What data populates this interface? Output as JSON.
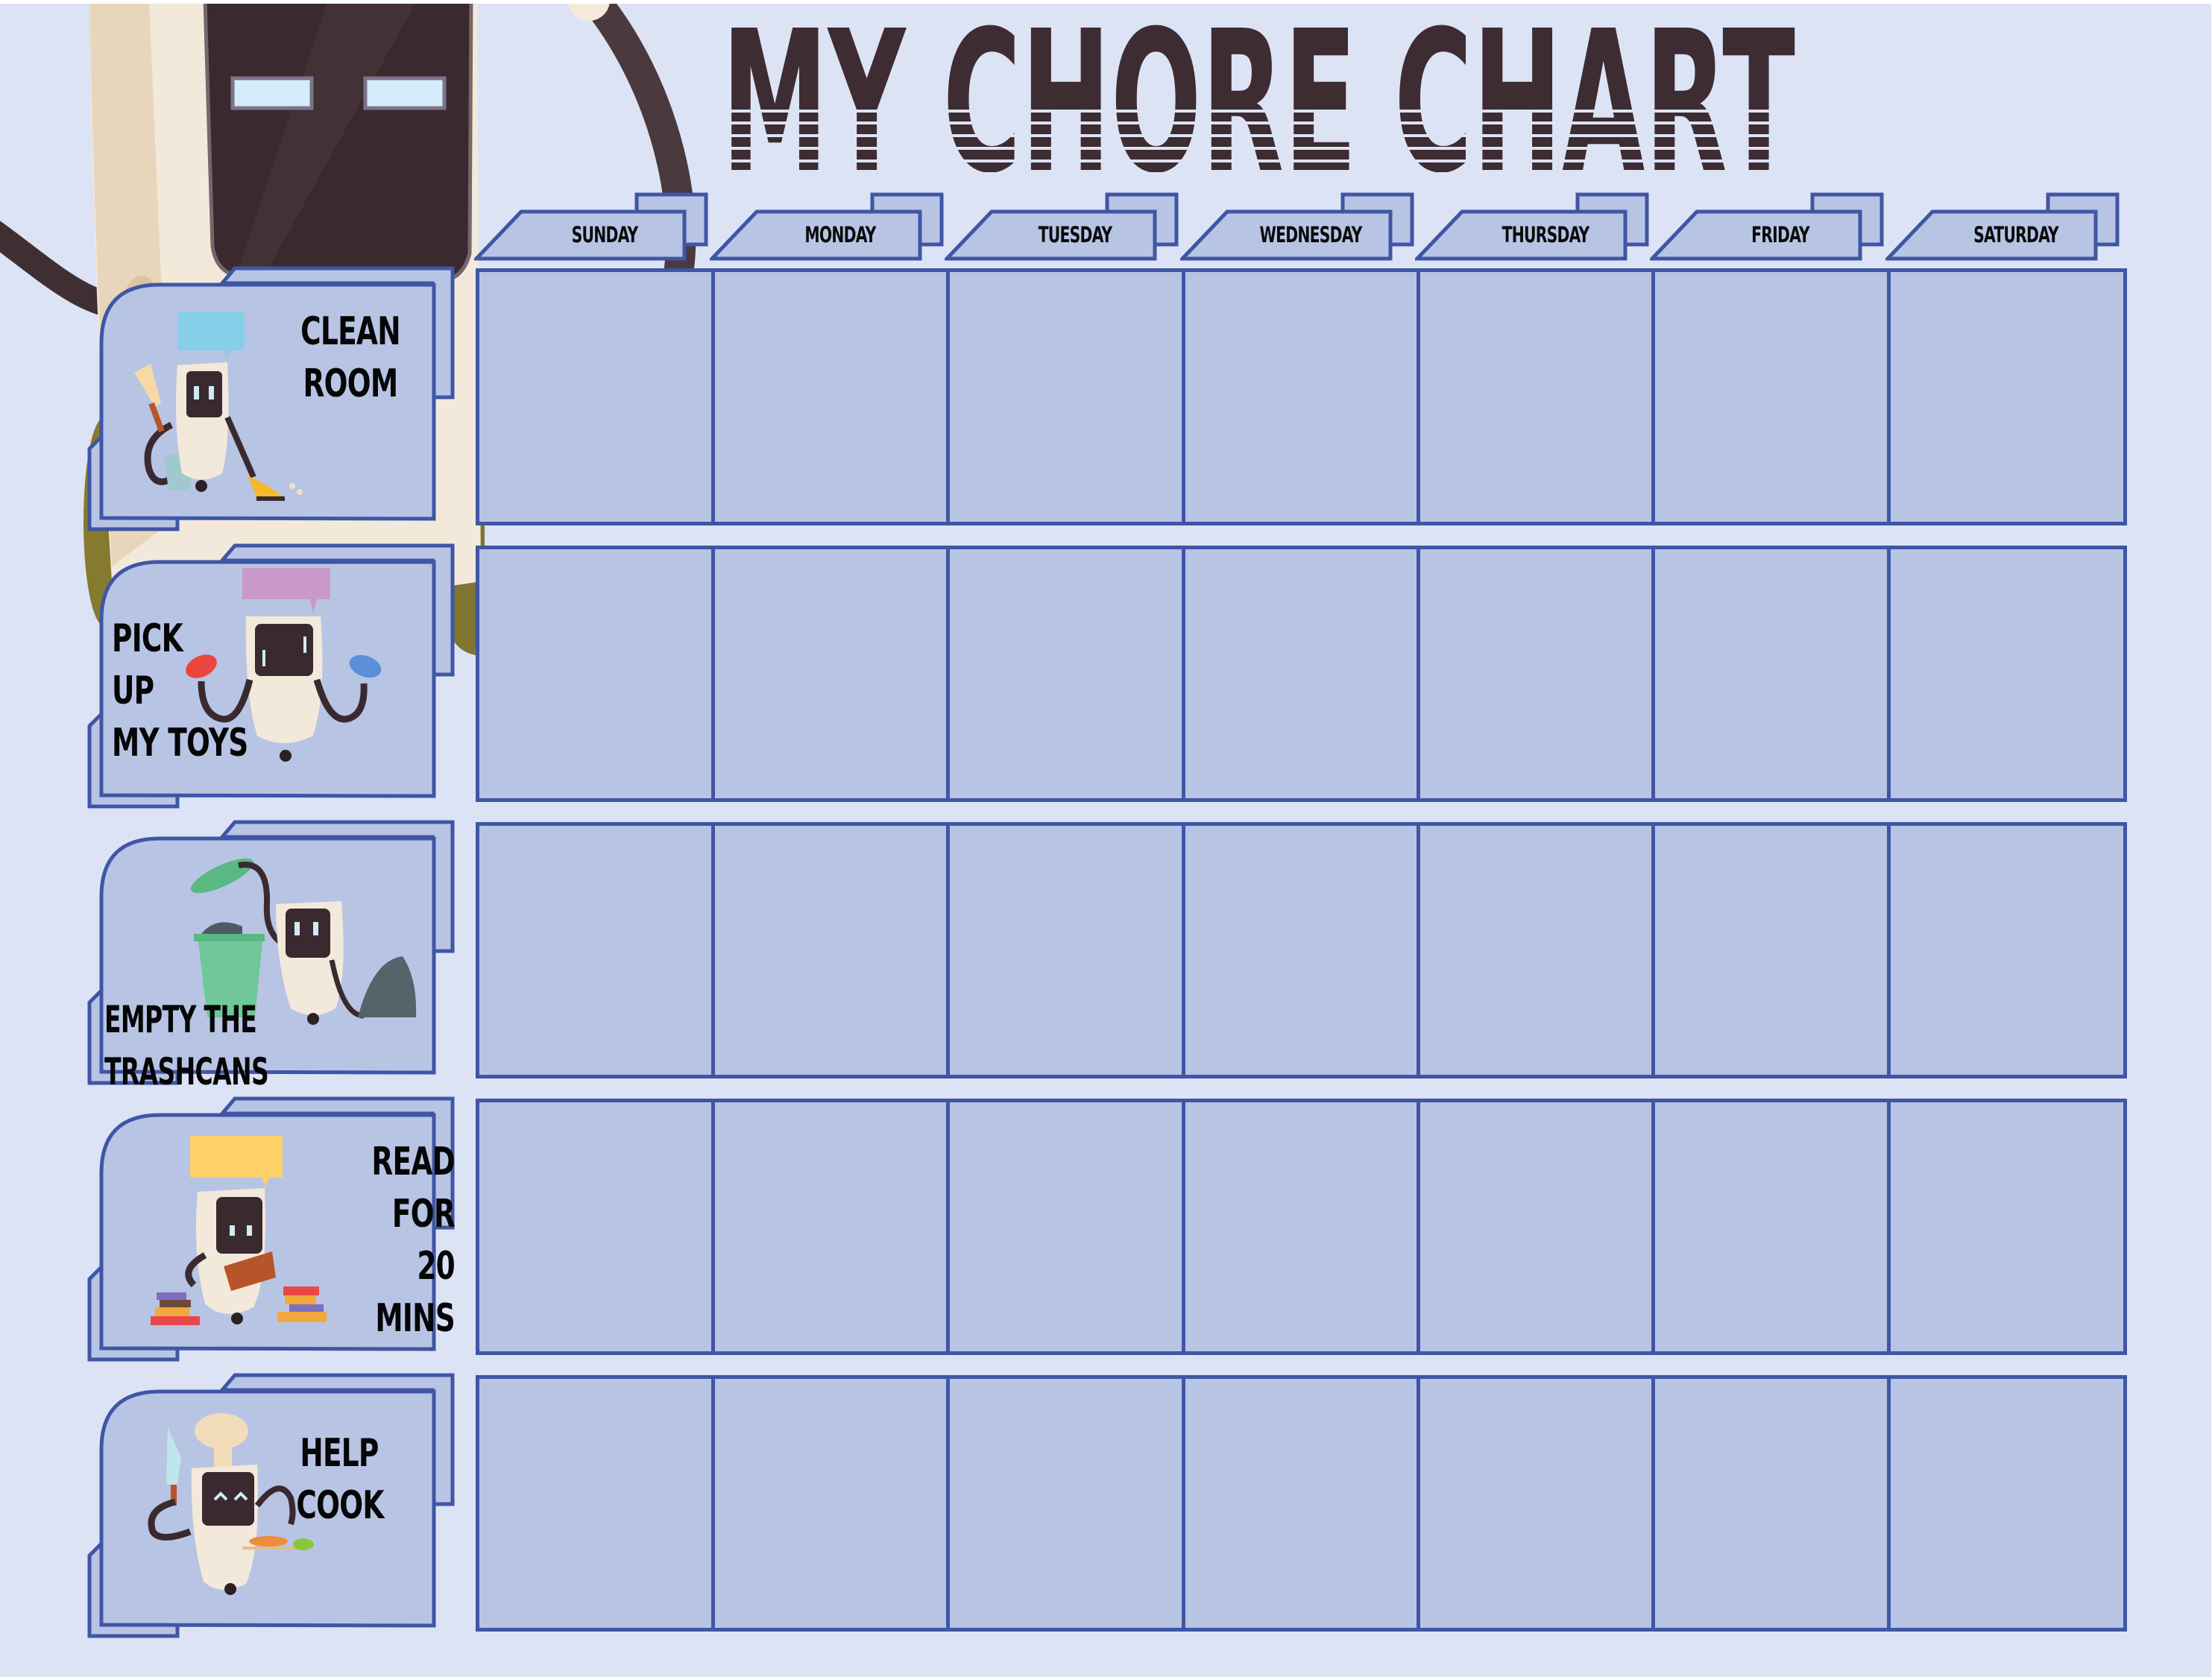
{
  "title": "MY CHORE CHART",
  "colors": {
    "background": "#dce3f4",
    "cell_fill": "#b8c4e4",
    "border": "#3f56a6",
    "title_text": "#3d2c31",
    "label_text": "#060606"
  },
  "days": [
    "SUNDAY",
    "MONDAY",
    "TUESDAY",
    "WEDNESDAY",
    "THURSDAY",
    "FRIDAY",
    "SATURDAY"
  ],
  "chores": [
    {
      "lines": [
        "CLEAN",
        "ROOM"
      ],
      "illustration": "robot-cleaning-icon",
      "bubble_color": "#86cfe9"
    },
    {
      "lines": [
        "PICK",
        "UP",
        "MY TOYS"
      ],
      "illustration": "robot-game-controllers-icon",
      "bubble_color": "#c99ac8"
    },
    {
      "lines": [
        "EMPTY THE TRASHCANS"
      ],
      "illustration": "robot-trashcan-icon",
      "bubble_color": ""
    },
    {
      "lines": [
        "READ",
        "FOR",
        "20 MINS"
      ],
      "illustration": "robot-reading-icon",
      "bubble_color": "#fdd068"
    },
    {
      "lines": [
        "HELP",
        "COOK"
      ],
      "illustration": "robot-chef-icon",
      "bubble_color": ""
    }
  ],
  "checkmarks": [
    [
      false,
      false,
      false,
      false,
      false,
      false,
      false
    ],
    [
      false,
      false,
      false,
      false,
      false,
      false,
      false
    ],
    [
      false,
      false,
      false,
      false,
      false,
      false,
      false
    ],
    [
      false,
      false,
      false,
      false,
      false,
      false,
      false
    ],
    [
      false,
      false,
      false,
      false,
      false,
      false,
      false
    ]
  ]
}
